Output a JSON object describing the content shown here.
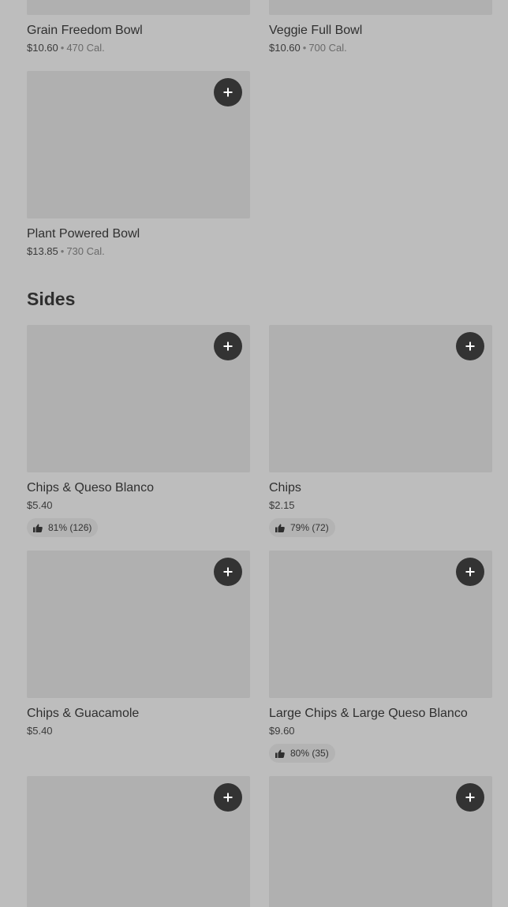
{
  "bowls": [
    {
      "name": "Grain Freedom Bowl",
      "price": "$10.60",
      "separator": "•",
      "calories": "470 Cal."
    },
    {
      "name": "Veggie Full Bowl",
      "price": "$10.60",
      "separator": "•",
      "calories": "700 Cal."
    },
    {
      "name": "Plant Powered Bowl",
      "price": "$13.85",
      "separator": "•",
      "calories": "730 Cal."
    }
  ],
  "sides": {
    "title": "Sides",
    "items": [
      {
        "name": "Chips & Queso Blanco",
        "price": "$5.40",
        "rating": "81% (126)"
      },
      {
        "name": "Chips",
        "price": "$2.15",
        "rating": "79% (72)"
      },
      {
        "name": "Chips & Guacamole",
        "price": "$5.40"
      },
      {
        "name": "Large Chips & Large Queso Blanco",
        "price": "$9.60",
        "rating": "80% (35)"
      }
    ]
  },
  "icons": {
    "add": "plus-icon",
    "rating": "thumbs-up-icon"
  },
  "colors": {
    "background": "#bdbdbd",
    "image_placeholder": "#b0b0b0",
    "add_button": "#333333"
  }
}
